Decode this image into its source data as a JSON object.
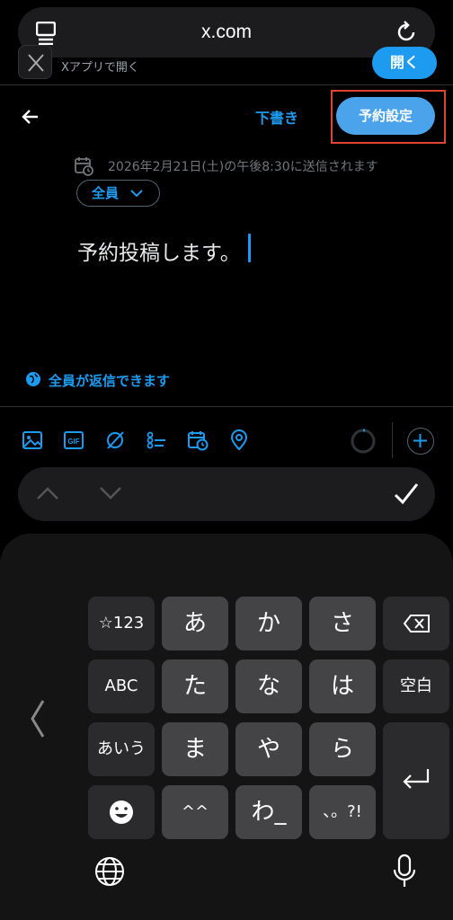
{
  "browser": {
    "url": "x.com",
    "banner_text": "Xアプリで開く",
    "banner_button": "開く"
  },
  "compose": {
    "drafts_label": "下書き",
    "schedule_button": "予約設定",
    "schedule_info": "2026年2月21日(土)の午後8:30に送信されます",
    "audience_label": "全員",
    "post_text": "予約投稿します。",
    "reply_setting": "全員が返信できます",
    "toolbar_icons": [
      "image-icon",
      "gif-icon",
      "grok-icon",
      "poll-icon",
      "schedule-icon",
      "location-icon"
    ],
    "accent_color": "#1d9bf0"
  },
  "keyboard": {
    "rows": [
      [
        "☆123",
        "あ",
        "か",
        "さ"
      ],
      [
        "ABC",
        "た",
        "な",
        "は"
      ],
      [
        "あいう",
        "ま",
        "や",
        "ら"
      ],
      [
        "",
        "^^",
        "わ_",
        "、。?!"
      ]
    ],
    "space_label": "空白"
  }
}
